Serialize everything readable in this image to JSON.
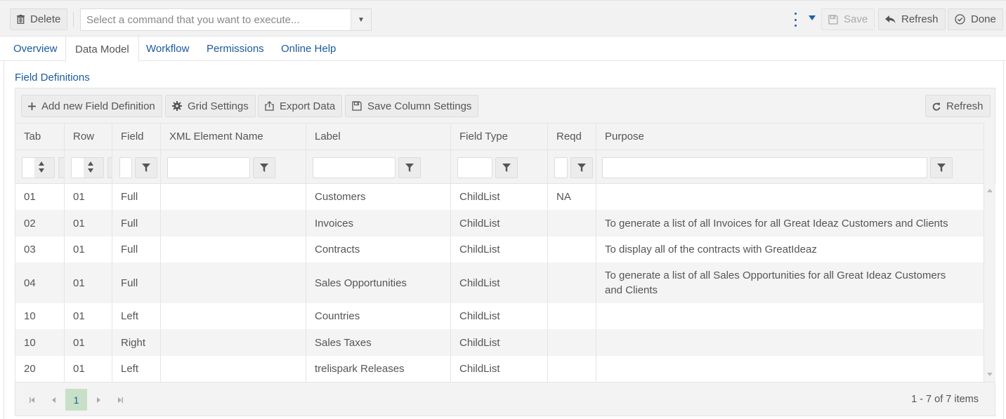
{
  "toolbar": {
    "delete_label": "Delete",
    "command_placeholder": "Select a command that you want to execute...",
    "save_label": "Save",
    "refresh_label": "Refresh",
    "done_label": "Done",
    "accent_color": "#1e5fa8"
  },
  "tabs": [
    {
      "label": "Overview",
      "active": false
    },
    {
      "label": "Data Model",
      "active": true
    },
    {
      "label": "Workflow",
      "active": false
    },
    {
      "label": "Permissions",
      "active": false
    },
    {
      "label": "Online Help",
      "active": false
    }
  ],
  "section": {
    "title": "Field Definitions"
  },
  "grid_toolbar": {
    "add_label": "Add new Field Definition",
    "settings_label": "Grid Settings",
    "export_label": "Export Data",
    "save_columns_label": "Save Column Settings",
    "refresh_label": "Refresh"
  },
  "columns": [
    "Tab",
    "Row",
    "Field",
    "XML Element Name",
    "Label",
    "Field Type",
    "Reqd",
    "Purpose"
  ],
  "rows": [
    {
      "tab": "01",
      "row": "01",
      "field": "Full",
      "xml": "",
      "label": "Customers",
      "type": "ChildList",
      "reqd": "NA",
      "purpose": ""
    },
    {
      "tab": "02",
      "row": "01",
      "field": "Full",
      "xml": "",
      "label": "Invoices",
      "type": "ChildList",
      "reqd": "",
      "purpose": "To generate a list of all Invoices for all Great Ideaz Customers and Clients"
    },
    {
      "tab": "03",
      "row": "01",
      "field": "Full",
      "xml": "",
      "label": "Contracts",
      "type": "ChildList",
      "reqd": "",
      "purpose": "To display all of the contracts with GreatIdeaz"
    },
    {
      "tab": "04",
      "row": "01",
      "field": "Full",
      "xml": "",
      "label": "Sales Opportunities",
      "type": "ChildList",
      "reqd": "",
      "purpose": "To generate a list of all Sales Opportunities for all Great Ideaz Customers and Clients"
    },
    {
      "tab": "10",
      "row": "01",
      "field": "Left",
      "xml": "",
      "label": "Countries",
      "type": "ChildList",
      "reqd": "",
      "purpose": ""
    },
    {
      "tab": "10",
      "row": "01",
      "field": "Right",
      "xml": "",
      "label": "Sales Taxes",
      "type": "ChildList",
      "reqd": "",
      "purpose": ""
    },
    {
      "tab": "20",
      "row": "01",
      "field": "Left",
      "xml": "",
      "label": "trelispark Releases",
      "type": "ChildList",
      "reqd": "",
      "purpose": ""
    }
  ],
  "pager": {
    "current_page": "1",
    "info": "1 - 7 of 7 items"
  }
}
